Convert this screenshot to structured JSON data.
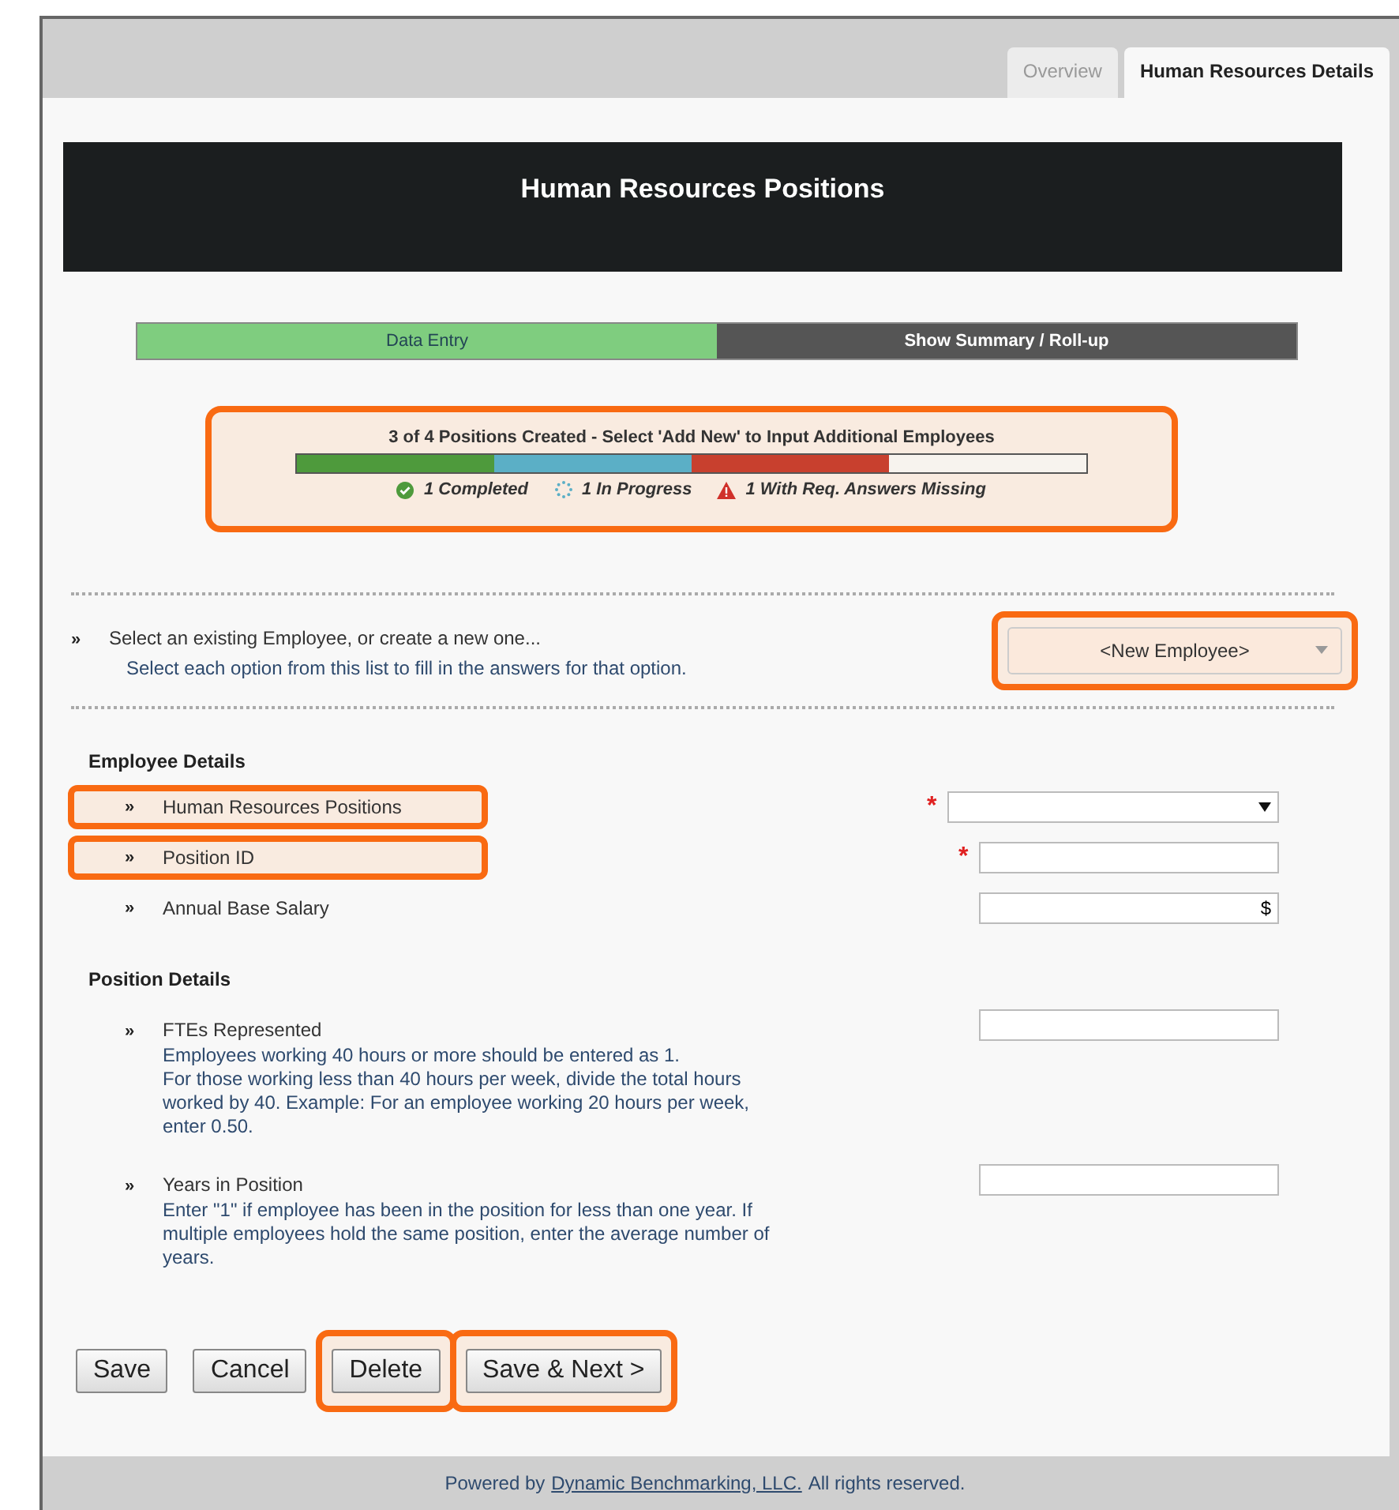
{
  "tabs": [
    {
      "label": "Overview",
      "selected": false
    },
    {
      "label": "Human Resources Details",
      "selected": true
    }
  ],
  "header": {
    "title": "Human Resources Positions"
  },
  "steps": [
    {
      "label": "Data Entry",
      "selected": true
    },
    {
      "label": "Show Summary / Roll-up",
      "selected": false
    }
  ],
  "status": {
    "highlighted": true,
    "message": "3 of 4 Positions Created - Select 'Add New' to Input Additional Employees",
    "segments": [
      {
        "color": "#4e9a3c"
      },
      {
        "color": "#5bafc6"
      },
      {
        "color": "#c8402e"
      }
    ],
    "legend": [
      {
        "kind": "completed",
        "label": "1 Completed"
      },
      {
        "kind": "progress",
        "label": "1 In Progress"
      },
      {
        "kind": "missing",
        "label": "1 With Req. Answers Missing"
      }
    ]
  },
  "selector": {
    "marker": "»",
    "label": "Select an existing Employee, or create a new one...",
    "hint": "Select each option from this list to fill in the answers for that option.",
    "value": "<New Employee>",
    "highlighted": true
  },
  "sections": [
    {
      "title": "Employee Details",
      "fields": [
        {
          "marker": "»",
          "label": "Human Resources Positions",
          "kind": "select",
          "required_mark": "*",
          "highlighted": true
        },
        {
          "marker": "»",
          "label": "Position ID",
          "kind": "text",
          "required_mark": "*",
          "highlighted": true
        },
        {
          "marker": "»",
          "label": "Annual Base Salary",
          "kind": "currency",
          "unit": "$",
          "highlighted": false
        }
      ]
    },
    {
      "title": "Position Details",
      "fields": [
        {
          "marker": "»",
          "label": "FTEs Represented",
          "kind": "text",
          "highlighted": false,
          "help": [
            "Employees working 40 hours or more should be entered as 1.",
            "For those working less than 40 hours per week, divide the total hours worked by 40. Example: For an employee working 20 hours per week, enter 0.50."
          ]
        },
        {
          "marker": "»",
          "label": "Years in Position",
          "kind": "text",
          "highlighted": false,
          "help": [
            "Enter \"1\" if employee has been in the position for less than one year. If multiple employees hold the same position, enter the average number of years."
          ]
        }
      ]
    }
  ],
  "buttons": [
    {
      "label": "Save",
      "highlighted": false
    },
    {
      "label": "Cancel",
      "highlighted": false
    },
    {
      "label": "Delete",
      "highlighted": true
    },
    {
      "label": "Save & Next >",
      "highlighted": true
    }
  ],
  "footer": {
    "before": "Powered by",
    "link": "Dynamic Benchmarking, LLC.",
    "after": "All rights reserved."
  }
}
